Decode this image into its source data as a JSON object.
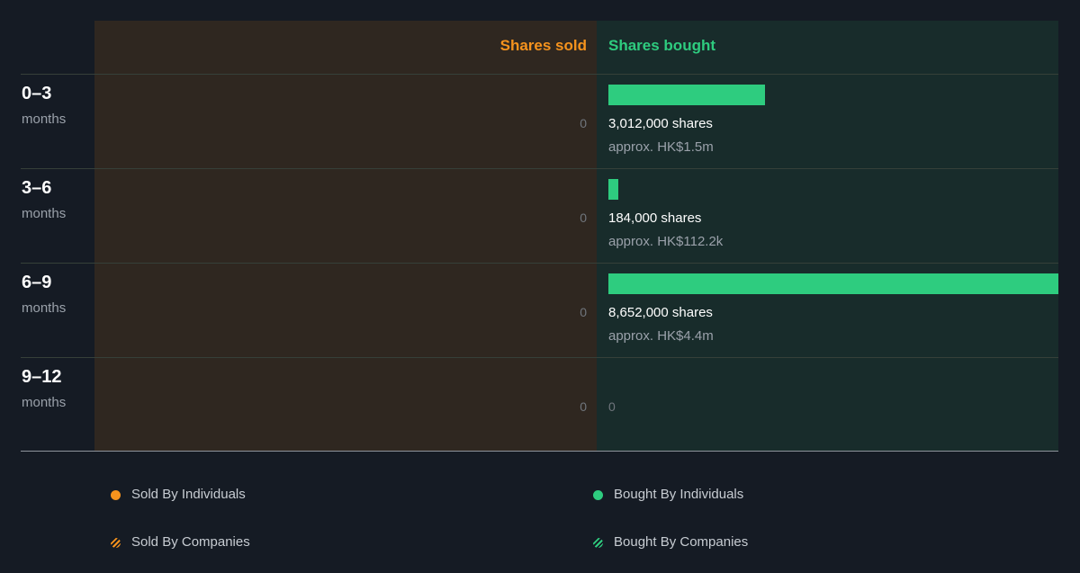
{
  "chart_data": {
    "type": "bar",
    "headers": {
      "sold": "Shares sold",
      "bought": "Shares bought"
    },
    "max_shares": 8652000,
    "rows": [
      {
        "range": "0–3",
        "unit": "months",
        "sold": "0",
        "bought_shares": 3012000,
        "bought_label": "3,012,000 shares",
        "bought_approx": "approx. HK$1.5m"
      },
      {
        "range": "3–6",
        "unit": "months",
        "sold": "0",
        "bought_shares": 184000,
        "bought_label": "184,000 shares",
        "bought_approx": "approx. HK$112.2k"
      },
      {
        "range": "6–9",
        "unit": "months",
        "sold": "0",
        "bought_shares": 8652000,
        "bought_label": "8,652,000 shares",
        "bought_approx": "approx. HK$4.4m"
      },
      {
        "range": "9–12",
        "unit": "months",
        "sold": "0",
        "bought_shares": 0,
        "bought_label": "",
        "bought_approx": "",
        "bought_zero": "0"
      }
    ],
    "legend": [
      {
        "label": "Sold By Individuals",
        "color": "#f6931d",
        "style": "solid"
      },
      {
        "label": "Bought By Individuals",
        "color": "#2ecc7f",
        "style": "solid"
      },
      {
        "label": "Sold By Companies",
        "color": "#f6931d",
        "style": "striped"
      },
      {
        "label": "Bought By Companies",
        "color": "#2ecc7f",
        "style": "striped"
      }
    ]
  }
}
